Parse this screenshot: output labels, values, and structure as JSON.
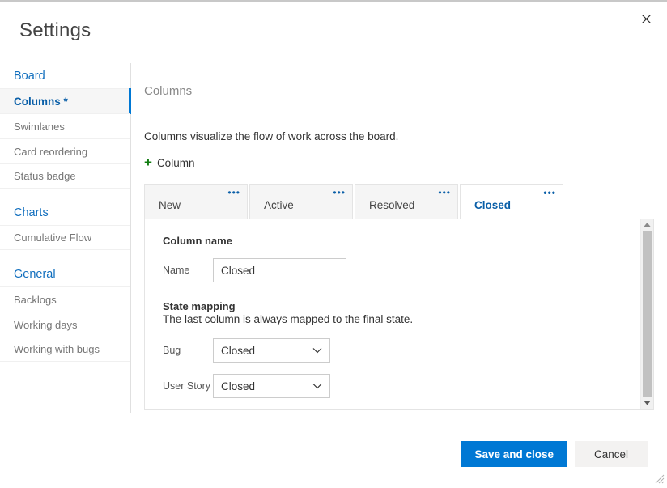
{
  "dialog": {
    "title": "Settings",
    "close_icon": "close-icon"
  },
  "sidebar": {
    "groups": [
      {
        "header": "Board",
        "items": [
          {
            "label": "Columns *",
            "selected": true
          },
          {
            "label": "Swimlanes",
            "selected": false
          },
          {
            "label": "Card reordering",
            "selected": false
          },
          {
            "label": "Status badge",
            "selected": false
          }
        ]
      },
      {
        "header": "Charts",
        "items": [
          {
            "label": "Cumulative Flow",
            "selected": false
          }
        ]
      },
      {
        "header": "General",
        "items": [
          {
            "label": "Backlogs",
            "selected": false
          },
          {
            "label": "Working days",
            "selected": false
          },
          {
            "label": "Working with bugs",
            "selected": false
          }
        ]
      }
    ]
  },
  "main": {
    "heading": "Columns",
    "description": "Columns visualize the flow of work across the board.",
    "add_column": {
      "icon": "plus-icon",
      "glyph": "+",
      "label": "Column"
    },
    "tabs": [
      {
        "label": "New",
        "active": false,
        "menu_icon": "ellipsis-icon",
        "menu_glyph": "•••"
      },
      {
        "label": "Active",
        "active": false,
        "menu_icon": "ellipsis-icon",
        "menu_glyph": "•••"
      },
      {
        "label": "Resolved",
        "active": false,
        "menu_icon": "ellipsis-icon",
        "menu_glyph": "•••"
      },
      {
        "label": "Closed",
        "active": true,
        "menu_icon": "ellipsis-icon",
        "menu_glyph": "•••"
      }
    ],
    "form": {
      "column_name_label": "Column name",
      "name_label": "Name",
      "name_value": "Closed",
      "name_placeholder": "",
      "state_mapping_label": "State mapping",
      "state_mapping_note": "The last column is always mapped to the final state.",
      "mappings": [
        {
          "label": "Bug",
          "value": "Closed"
        },
        {
          "label": "User Story",
          "value": "Closed"
        }
      ]
    },
    "scrollbar": {
      "up_icon": "chevron-up-icon",
      "down_icon": "chevron-down-icon"
    }
  },
  "footer": {
    "save_label": "Save and close",
    "cancel_label": "Cancel"
  },
  "colors": {
    "accent": "#0078d4",
    "link": "#106ebe",
    "selected_text": "#0a5fa8",
    "plus_green": "#107c10",
    "scroll_thumb": "#c1c1c1"
  }
}
